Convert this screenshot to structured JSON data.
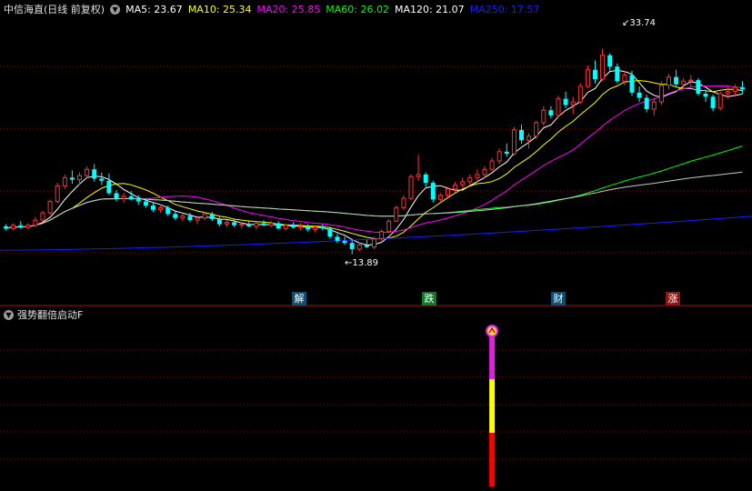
{
  "stock": {
    "title": "中信海直(日线 前复权)"
  },
  "ma_legend": [
    {
      "label": "MA5: 23.67",
      "color": "#ffffff"
    },
    {
      "label": "MA10: 25.34",
      "color": "#ffff00"
    },
    {
      "label": "MA20: 25.85",
      "color": "#ff00ff"
    },
    {
      "label": "MA60: 26.02",
      "color": "#00ff00"
    },
    {
      "label": "MA120: 21.07",
      "color": "#ffffff"
    },
    {
      "label": "MA250: 17.57",
      "color": "#1c1cff"
    }
  ],
  "annotations": {
    "high": "33.74",
    "low": "13.89"
  },
  "event_markers": [
    {
      "label": "解",
      "bg": "#0a4f74"
    },
    {
      "label": "跌",
      "bg": "#0d7a2a"
    },
    {
      "label": "财",
      "bg": "#0a4f74"
    },
    {
      "label": "涨",
      "bg": "#8a1616"
    }
  ],
  "indicator": {
    "title": "强势翻倍启动F"
  },
  "icons": {
    "dropdown": "chevron-down-icon",
    "signal": "up-arrow-circle-icon"
  },
  "colors": {
    "up": "#ff3232",
    "down": "#00ffff",
    "grid": "#8a1010",
    "signal_top": "#e020e0",
    "signal_mid": "#ffff00",
    "signal_bot": "#ff0000"
  },
  "chart_data": {
    "type": "candlestick",
    "candles": [
      [
        16.6,
        16.8,
        16.2,
        16.4
      ],
      [
        16.4,
        16.9,
        16.2,
        16.7
      ],
      [
        16.7,
        17.1,
        16.4,
        16.5
      ],
      [
        16.5,
        16.9,
        16.3,
        16.7
      ],
      [
        16.7,
        17.5,
        16.5,
        17.2
      ],
      [
        17.2,
        18.1,
        17.0,
        17.9
      ],
      [
        17.9,
        19.2,
        17.7,
        19.0
      ],
      [
        19.0,
        20.8,
        18.8,
        20.5
      ],
      [
        20.5,
        21.6,
        20.2,
        21.3
      ],
      [
        21.3,
        22.0,
        20.7,
        21.1
      ],
      [
        21.1,
        21.8,
        20.6,
        21.5
      ],
      [
        21.5,
        22.4,
        21.2,
        22.1
      ],
      [
        22.1,
        22.6,
        20.9,
        21.2
      ],
      [
        21.2,
        21.8,
        20.6,
        21.0
      ],
      [
        21.0,
        21.7,
        19.6,
        19.8
      ],
      [
        19.8,
        20.1,
        19.0,
        19.3
      ],
      [
        19.3,
        19.8,
        18.9,
        19.5
      ],
      [
        19.5,
        20.0,
        19.1,
        19.2
      ],
      [
        19.2,
        19.6,
        18.7,
        19.0
      ],
      [
        19.0,
        19.3,
        18.4,
        18.6
      ],
      [
        18.6,
        18.9,
        18.0,
        18.2
      ],
      [
        18.2,
        18.7,
        17.9,
        18.4
      ],
      [
        18.4,
        18.6,
        17.6,
        17.8
      ],
      [
        17.8,
        18.1,
        17.2,
        17.4
      ],
      [
        17.4,
        17.8,
        17.1,
        17.6
      ],
      [
        17.6,
        17.9,
        17.0,
        17.2
      ],
      [
        17.2,
        17.6,
        16.8,
        17.4
      ],
      [
        17.4,
        18.0,
        17.2,
        17.8
      ],
      [
        17.8,
        18.0,
        17.1,
        17.3
      ],
      [
        17.3,
        17.6,
        16.6,
        16.8
      ],
      [
        16.8,
        17.2,
        16.5,
        17.0
      ],
      [
        17.0,
        17.3,
        16.5,
        16.7
      ],
      [
        16.7,
        17.0,
        16.4,
        16.8
      ],
      [
        16.8,
        17.1,
        16.5,
        16.6
      ],
      [
        16.6,
        17.0,
        16.3,
        16.9
      ],
      [
        16.9,
        17.2,
        16.6,
        16.7
      ],
      [
        16.7,
        17.1,
        16.5,
        16.9
      ],
      [
        16.9,
        17.1,
        16.3,
        16.4
      ],
      [
        16.4,
        16.8,
        16.2,
        16.7
      ],
      [
        16.7,
        17.0,
        16.4,
        16.5
      ],
      [
        16.5,
        16.9,
        16.2,
        16.6
      ],
      [
        16.6,
        16.8,
        16.1,
        16.3
      ],
      [
        16.3,
        16.7,
        16.0,
        16.5
      ],
      [
        16.5,
        16.8,
        16.2,
        16.4
      ],
      [
        16.4,
        16.6,
        15.4,
        15.6
      ],
      [
        15.6,
        15.9,
        15.0,
        15.2
      ],
      [
        15.2,
        15.6,
        14.8,
        15.0
      ],
      [
        15.0,
        15.4,
        13.89,
        14.4
      ],
      [
        14.4,
        15.0,
        14.2,
        14.8
      ],
      [
        14.8,
        15.3,
        14.5,
        14.6
      ],
      [
        14.6,
        15.6,
        14.4,
        15.4
      ],
      [
        15.4,
        16.3,
        15.2,
        16.1
      ],
      [
        16.1,
        17.3,
        15.9,
        17.1
      ],
      [
        17.1,
        18.6,
        17.0,
        18.4
      ],
      [
        18.4,
        19.6,
        18.2,
        19.3
      ],
      [
        19.3,
        21.6,
        19.1,
        21.4
      ],
      [
        21.4,
        23.5,
        21.0,
        21.6
      ],
      [
        21.6,
        21.8,
        20.4,
        20.8
      ],
      [
        20.8,
        21.0,
        18.9,
        19.2
      ],
      [
        19.2,
        19.8,
        18.8,
        19.6
      ],
      [
        19.6,
        20.4,
        19.4,
        20.2
      ],
      [
        20.2,
        20.9,
        19.9,
        20.6
      ],
      [
        20.6,
        21.3,
        20.3,
        20.9
      ],
      [
        20.9,
        21.6,
        20.6,
        21.3
      ],
      [
        21.3,
        22.1,
        20.9,
        21.6
      ],
      [
        21.6,
        22.4,
        21.2,
        22.1
      ],
      [
        22.1,
        23.2,
        21.9,
        22.9
      ],
      [
        22.9,
        24.1,
        22.6,
        23.8
      ],
      [
        23.8,
        24.6,
        23.3,
        23.6
      ],
      [
        23.6,
        26.2,
        23.4,
        25.9
      ],
      [
        25.9,
        26.4,
        24.6,
        24.9
      ],
      [
        24.9,
        25.6,
        24.1,
        25.3
      ],
      [
        25.3,
        26.8,
        25.0,
        26.6
      ],
      [
        26.6,
        28.2,
        26.3,
        27.8
      ],
      [
        27.8,
        28.2,
        27.0,
        27.3
      ],
      [
        27.3,
        29.2,
        27.1,
        28.9
      ],
      [
        28.9,
        29.6,
        28.0,
        28.3
      ],
      [
        28.3,
        29.1,
        27.4,
        28.6
      ],
      [
        28.6,
        30.4,
        28.4,
        30.1
      ],
      [
        30.1,
        32.1,
        29.9,
        31.7
      ],
      [
        31.7,
        32.6,
        30.4,
        30.8
      ],
      [
        30.8,
        33.74,
        30.6,
        33.1
      ],
      [
        33.1,
        33.3,
        31.6,
        32.0
      ],
      [
        32.0,
        32.3,
        30.4,
        30.6
      ],
      [
        30.6,
        31.6,
        30.2,
        31.2
      ],
      [
        31.2,
        31.6,
        29.2,
        29.5
      ],
      [
        29.5,
        30.1,
        28.6,
        29.0
      ],
      [
        29.0,
        29.3,
        27.6,
        27.9
      ],
      [
        27.9,
        28.9,
        27.3,
        28.6
      ],
      [
        28.6,
        30.6,
        28.3,
        30.2
      ],
      [
        30.2,
        31.3,
        29.8,
        31.0
      ],
      [
        31.0,
        31.7,
        30.1,
        30.3
      ],
      [
        30.3,
        30.9,
        29.8,
        30.6
      ],
      [
        30.6,
        31.2,
        30.1,
        30.7
      ],
      [
        30.7,
        30.9,
        29.2,
        29.4
      ],
      [
        29.4,
        29.8,
        28.6,
        29.1
      ],
      [
        29.1,
        29.3,
        27.7,
        28.0
      ],
      [
        28.0,
        29.6,
        27.8,
        29.4
      ],
      [
        29.4,
        30.1,
        28.9,
        29.6
      ],
      [
        29.6,
        30.3,
        29.1,
        30.0
      ],
      [
        30.0,
        30.6,
        29.4,
        29.8
      ]
    ],
    "price_range": [
      13.0,
      36.5
    ],
    "ma250_range": [
      14.3,
      17.57
    ],
    "signal_candle_index": 66
  }
}
